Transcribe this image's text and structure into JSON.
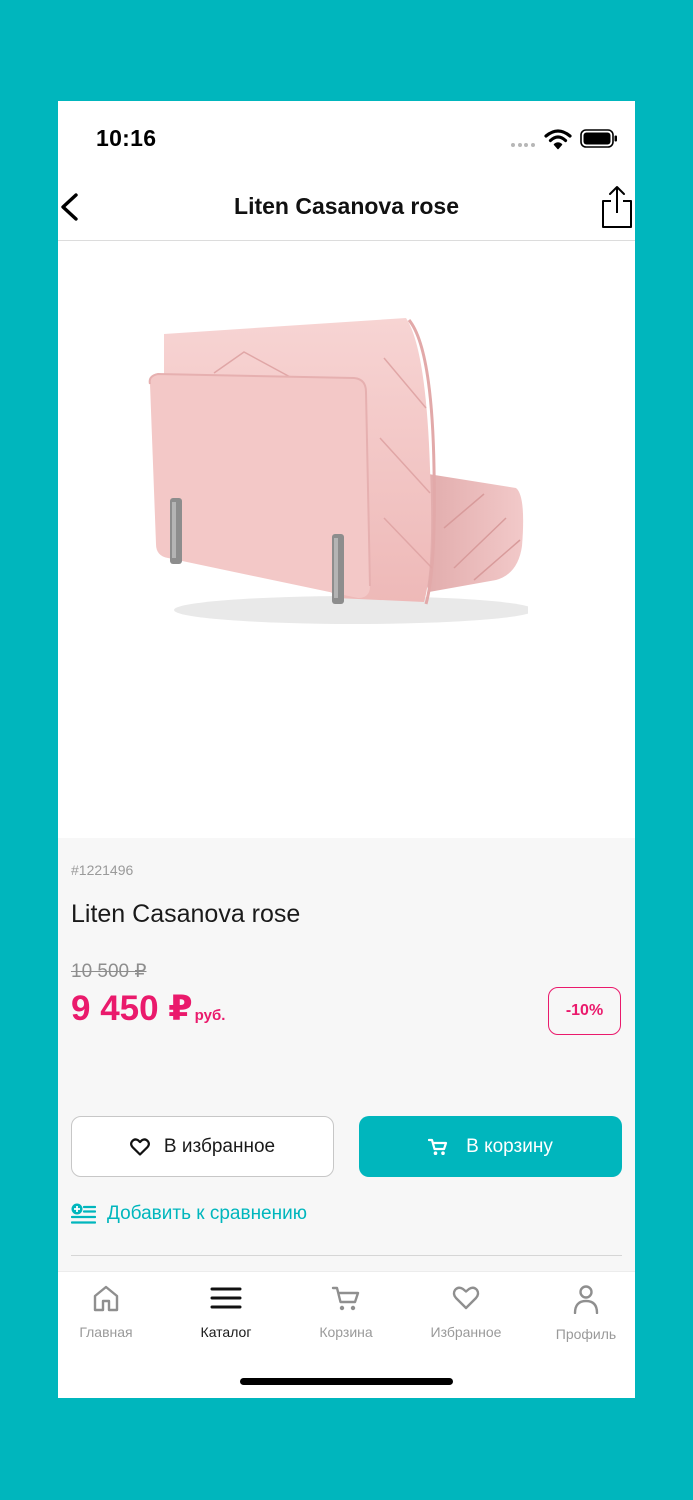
{
  "status_bar": {
    "time": "10:16",
    "icons": [
      "signal-icon",
      "wifi-icon",
      "battery-icon"
    ]
  },
  "nav": {
    "title": "Liten Casanova rose",
    "back_icon": "chevron-left-icon",
    "share_icon": "share-icon"
  },
  "product": {
    "image": "pink-sofa-bed-photo",
    "color_swatch": "#ff7b7b",
    "sku": "#1221496",
    "name": "Liten Casanova rose",
    "old_price": "10 500 ₽",
    "price": "9 450 ₽",
    "price_unit": "руб.",
    "discount": "-10%"
  },
  "actions": {
    "favorite_label": "В избранное",
    "cart_label": "В корзину",
    "compare_label": "Добавить к сравнению"
  },
  "tabs": [
    {
      "label": "Главная",
      "icon": "home-icon",
      "active": false
    },
    {
      "label": "Каталог",
      "icon": "menu-icon",
      "active": true
    },
    {
      "label": "Корзина",
      "icon": "cart-icon",
      "active": false
    },
    {
      "label": "Избранное",
      "icon": "heart-icon",
      "active": false
    },
    {
      "label": "Профиль",
      "icon": "user-icon",
      "active": false
    }
  ],
  "colors": {
    "accent": "#00b6bd",
    "price": "#ea1a6c",
    "swatch": "#ff7b7b"
  }
}
